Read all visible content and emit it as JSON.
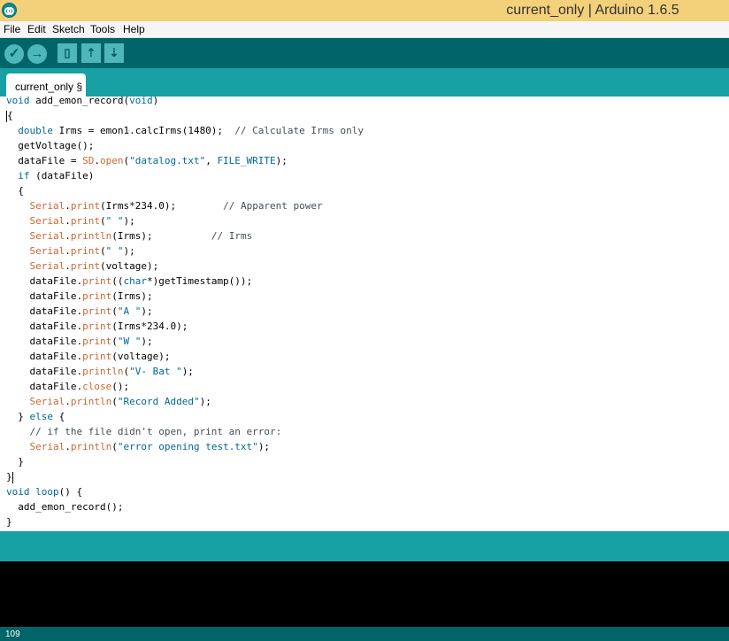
{
  "window": {
    "title": "current_only | Arduino 1.6.5"
  },
  "menu": [
    "File",
    "Edit",
    "Sketch",
    "Tools",
    "Help"
  ],
  "toolbar": {
    "buttons": [
      "verify-icon",
      "upload-icon",
      "new-icon",
      "open-icon",
      "save-icon"
    ]
  },
  "tab": {
    "label": "current_only §"
  },
  "code": [
    "void add_emon_record(void)",
    "{",
    "  double Irms = emon1.calcIrms(1480);  // Calculate Irms only",
    "  getVoltage();",
    "  dataFile = SD.open(\"datalog.txt\", FILE_WRITE);",
    "  if (dataFile)",
    "  {",
    "    Serial.print(Irms*234.0);        // Apparent power",
    "    Serial.print(\" \");",
    "    Serial.println(Irms);          // Irms",
    "    Serial.print(\" \");",
    "    Serial.print(voltage);",
    "    dataFile.print((char*)getTimestamp());",
    "    dataFile.print(Irms);",
    "    dataFile.print(\"A \");",
    "    dataFile.print(Irms*234.0);",
    "    dataFile.print(\"W \");",
    "    dataFile.print(voltage);",
    "    dataFile.println(\"V- Bat \");",
    "    dataFile.close();",
    "    Serial.println(\"Record Added\");",
    "  } else {",
    "    // if the file didn't open, print an error:",
    "    Serial.println(\"error opening test.txt\");",
    "  }",
    "}",
    "void loop() {",
    "  add_emon_record();",
    "}"
  ],
  "status": {
    "line_number": "109"
  }
}
